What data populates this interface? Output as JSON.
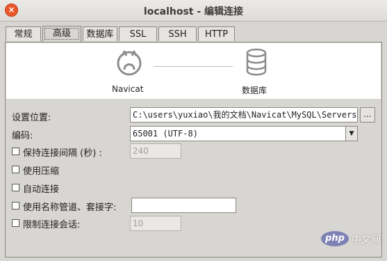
{
  "window": {
    "title": "localhost - 编辑连接",
    "close_glyph": "×"
  },
  "tabs": [
    {
      "label": "常规"
    },
    {
      "label": "高级",
      "active": true
    },
    {
      "label": "数据库"
    },
    {
      "label": "SSL"
    },
    {
      "label": "SSH"
    },
    {
      "label": "HTTP"
    }
  ],
  "diagram": {
    "left_label": "Navicat",
    "right_label": "数据库",
    "left_icon": "navicat-icon",
    "right_icon": "database-icon"
  },
  "settings": {
    "location_label": "设置位置:",
    "location_value": "C:\\users\\yuxiao\\我的文档\\Navicat\\MySQL\\Servers\\",
    "browse_label": "...",
    "encoding_label": "编码:",
    "encoding_value": "65001 (UTF-8)",
    "keepalive_label": "保持连接间隔 (秒) :",
    "keepalive_value": "240",
    "compress_label": "使用压缩",
    "autoconnect_label": "自动连接",
    "pipe_label": "使用名称管道、套接字:",
    "pipe_value": "",
    "limit_label": "限制连接会话:",
    "limit_value": "10"
  },
  "watermark": {
    "brand": "php",
    "text": "中文网"
  },
  "colors": {
    "accent": "#e9572a",
    "watermark_purple": "#7d81b5"
  }
}
